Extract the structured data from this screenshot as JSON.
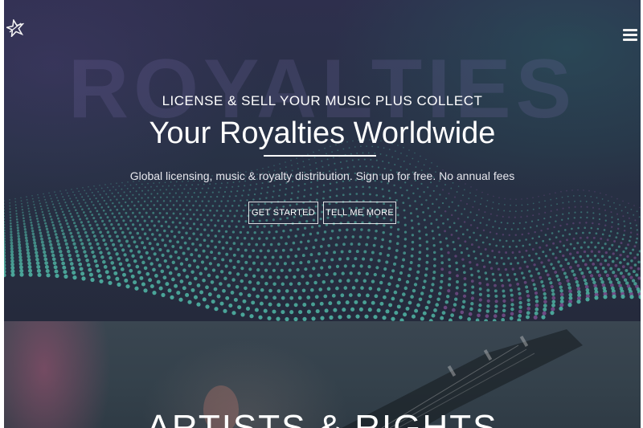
{
  "hero": {
    "background_word": "ROYALTIES",
    "eyebrow": "LICENSE & SELL YOUR MUSIC PLUS COLLECT",
    "headline": "Your Royalties Worldwide",
    "subtitle": "Global licensing, music & royalty distribution. Sign up for free. No annual fees",
    "buttons": {
      "get_started": "GET STARTED",
      "tell_me_more": "TELL ME MORE"
    }
  },
  "nav": {
    "logo_icon": "star-logo-icon",
    "menu_icon": "hamburger-menu-icon"
  },
  "section2": {
    "title": "ARTISTS & RIGHTS"
  },
  "colors": {
    "wave_teal": "#4fb3a3",
    "wave_purple": "#7a4f8e",
    "hero_bg": "#283246"
  }
}
